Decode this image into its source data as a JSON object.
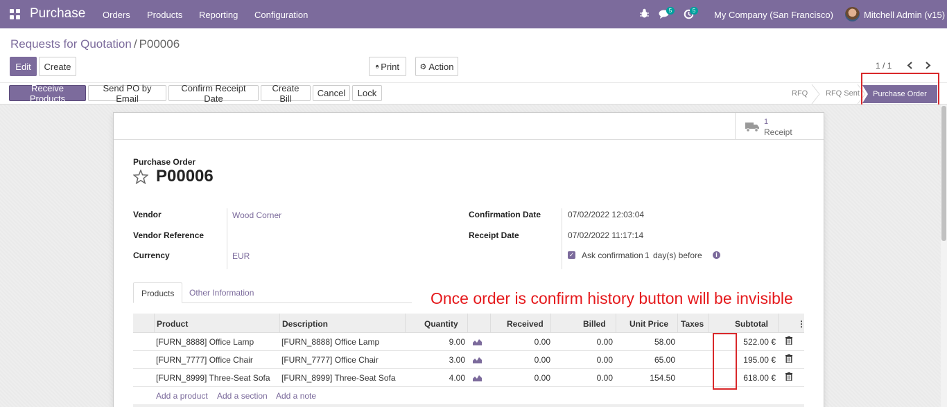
{
  "navbar": {
    "app_name": "Purchase",
    "menu": [
      "Orders",
      "Products",
      "Reporting",
      "Configuration"
    ],
    "messages_count": "5",
    "activities_count": "5",
    "company": "My Company (San Francisco)",
    "user": "Mitchell Admin (v15)"
  },
  "breadcrumb": {
    "parent": "Requests for Quotation",
    "separator": "/",
    "current": "P00006"
  },
  "toolbar": {
    "edit": "Edit",
    "create": "Create",
    "print": "Print",
    "action": "Action",
    "pager": "1 / 1"
  },
  "header_buttons": [
    "Receive Products",
    "Send PO by Email",
    "Confirm Receipt Date",
    "Create Bill",
    "Cancel",
    "Lock"
  ],
  "stages": {
    "rfq": "RFQ",
    "rfq_sent": "RFQ Sent",
    "purchase_order": "Purchase Order"
  },
  "smart_button": {
    "count": "1",
    "label": "Receipt"
  },
  "form": {
    "title_label": "Purchase Order",
    "name": "P00006",
    "vendor_label": "Vendor",
    "vendor": "Wood Corner",
    "vendor_ref_label": "Vendor Reference",
    "vendor_ref": "",
    "currency_label": "Currency",
    "currency": "EUR",
    "confirmation_date_label": "Confirmation Date",
    "confirmation_date": "07/02/2022 12:03:04",
    "receipt_date_label": "Receipt Date",
    "receipt_date": "07/02/2022 11:17:14",
    "ask_confirmation_prefix": "Ask confirmation",
    "ask_confirmation_days": "1",
    "ask_confirmation_suffix": "day(s) before"
  },
  "tabs": [
    "Products",
    "Other Information"
  ],
  "table": {
    "headers": [
      "Product",
      "Description",
      "Quantity",
      "Received",
      "Billed",
      "Unit Price",
      "Taxes",
      "Subtotal"
    ],
    "rows": [
      {
        "product": "[FURN_8888] Office Lamp",
        "description": "[FURN_8888] Office Lamp",
        "quantity": "9.00",
        "received": "0.00",
        "billed": "0.00",
        "unit_price": "58.00",
        "taxes": "",
        "subtotal": "522.00 €"
      },
      {
        "product": "[FURN_7777] Office Chair",
        "description": "[FURN_7777] Office Chair",
        "quantity": "3.00",
        "received": "0.00",
        "billed": "0.00",
        "unit_price": "65.00",
        "taxes": "",
        "subtotal": "195.00 €"
      },
      {
        "product": "[FURN_8999] Three-Seat Sofa",
        "description": "[FURN_8999] Three-Seat Sofa",
        "quantity": "4.00",
        "received": "0.00",
        "billed": "0.00",
        "unit_price": "154.50",
        "taxes": "",
        "subtotal": "618.00 €"
      }
    ],
    "add_links": [
      "Add a product",
      "Add a section",
      "Add a note"
    ]
  },
  "annotation": "Once order is confirm history button will be invisible",
  "colors": {
    "brand": "#7c6b9c",
    "annotation": "#e5191c"
  }
}
